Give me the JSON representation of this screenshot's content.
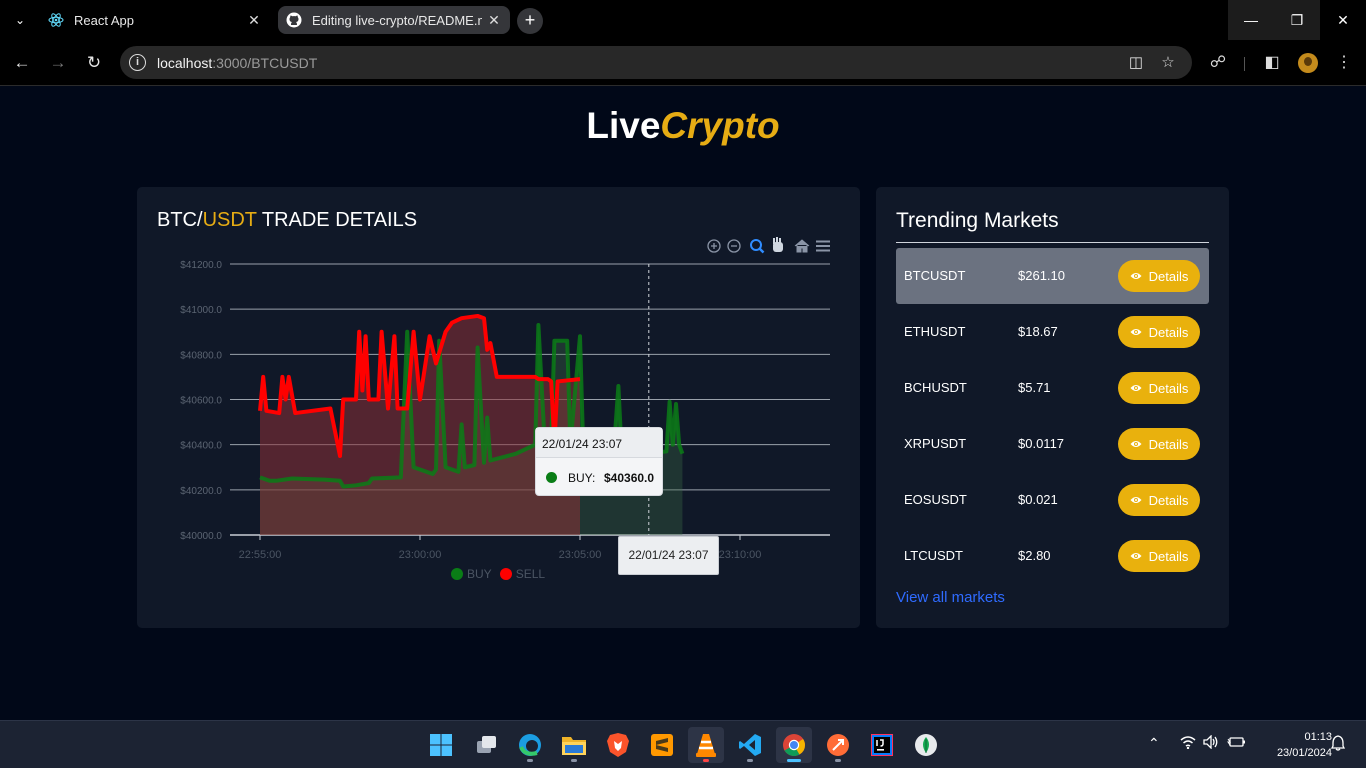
{
  "browser": {
    "tabs": [
      {
        "title": "React App",
        "active": false
      },
      {
        "title": "Editing live-crypto/README.md",
        "active": true
      }
    ],
    "url_host": "localhost",
    "url_path": ":3000/BTCUSDT"
  },
  "brand": {
    "first": "Live",
    "second": "Crypto"
  },
  "trade": {
    "title_base": "BTC/",
    "title_quote": "USDT",
    "title_rest": " TRADE DETAILS"
  },
  "chart_data": {
    "type": "area",
    "title": "BTC/USDT TRADE DETAILS",
    "xlabel": "",
    "ylabel": "",
    "x_ticks": [
      "22:55:00",
      "23:00:00",
      "23:05:00",
      "23:10:00"
    ],
    "y_ticks": [
      "$41200.0",
      "$41000.0",
      "$40800.0",
      "$40600.0",
      "$40400.0",
      "$40200.0",
      "$40000.0"
    ],
    "ylim": [
      40000,
      41200
    ],
    "grid": true,
    "legend": "bottom-center",
    "series": [
      {
        "name": "BUY",
        "color": "#0a7d16",
        "points": [
          [
            0.0,
            40255
          ],
          [
            0.3,
            40240
          ],
          [
            0.5,
            40240
          ],
          [
            1.0,
            40250
          ],
          [
            2.0,
            40245
          ],
          [
            2.5,
            40240
          ],
          [
            2.6,
            40215
          ],
          [
            3.0,
            40220
          ],
          [
            3.4,
            40230
          ],
          [
            3.5,
            40250
          ],
          [
            4.4,
            40255
          ],
          [
            4.6,
            40900
          ],
          [
            4.8,
            40300
          ],
          [
            5.4,
            40270
          ],
          [
            5.5,
            40290
          ],
          [
            5.6,
            40860
          ],
          [
            5.8,
            40300
          ],
          [
            6.2,
            40280
          ],
          [
            6.3,
            40490
          ],
          [
            6.4,
            40300
          ],
          [
            6.7,
            40310
          ],
          [
            6.8,
            40830
          ],
          [
            7.0,
            40320
          ],
          [
            7.1,
            40520
          ],
          [
            7.2,
            40330
          ],
          [
            8.0,
            40360
          ],
          [
            8.6,
            40400
          ],
          [
            8.7,
            40930
          ],
          [
            8.9,
            40400
          ],
          [
            9.1,
            40420
          ],
          [
            9.2,
            40860
          ],
          [
            9.6,
            40860
          ],
          [
            9.7,
            40400
          ],
          [
            10.0,
            40880
          ],
          [
            10.1,
            40390
          ],
          [
            10.3,
            40400
          ],
          [
            10.5,
            40260
          ],
          [
            11.0,
            40260
          ],
          [
            11.2,
            40660
          ],
          [
            11.3,
            40370
          ],
          [
            12.0,
            40360
          ],
          [
            12.7,
            40370
          ],
          [
            12.8,
            40590
          ],
          [
            12.9,
            40400
          ],
          [
            13.0,
            40580
          ],
          [
            13.1,
            40400
          ],
          [
            13.2,
            40360
          ]
        ]
      },
      {
        "name": "SELL",
        "color": "#ff0000",
        "points": [
          [
            0.0,
            40550
          ],
          [
            0.1,
            40700
          ],
          [
            0.2,
            40550
          ],
          [
            0.6,
            40540
          ],
          [
            0.7,
            40700
          ],
          [
            0.8,
            40600
          ],
          [
            0.9,
            40700
          ],
          [
            1.1,
            40540
          ],
          [
            2.2,
            40560
          ],
          [
            2.5,
            40350
          ],
          [
            2.6,
            40600
          ],
          [
            3.0,
            40600
          ],
          [
            3.1,
            40900
          ],
          [
            3.2,
            40640
          ],
          [
            3.3,
            40880
          ],
          [
            3.4,
            40600
          ],
          [
            3.7,
            40600
          ],
          [
            3.8,
            40900
          ],
          [
            4.0,
            40560
          ],
          [
            4.2,
            40880
          ],
          [
            4.3,
            40560
          ],
          [
            4.6,
            40560
          ],
          [
            4.8,
            40900
          ],
          [
            5.0,
            40600
          ],
          [
            5.3,
            40880
          ],
          [
            5.5,
            40760
          ],
          [
            5.8,
            40900
          ],
          [
            6.0,
            40940
          ],
          [
            6.3,
            40960
          ],
          [
            6.8,
            40970
          ],
          [
            7.0,
            40960
          ],
          [
            7.1,
            40820
          ],
          [
            7.2,
            40850
          ],
          [
            7.4,
            40700
          ],
          [
            8.6,
            40700
          ],
          [
            8.7,
            40690
          ],
          [
            9.0,
            40690
          ],
          [
            9.1,
            40680
          ],
          [
            9.2,
            40400
          ],
          [
            9.3,
            40680
          ],
          [
            10.0,
            40690
          ]
        ]
      }
    ],
    "tooltip": {
      "time": "22/01/24 23:07",
      "series": "BUY",
      "value": "$40360.0"
    },
    "crosshair_label": "22/01/24 23:07"
  },
  "toolbar_icons": [
    "zoom-in-icon",
    "zoom-out-icon",
    "selection-zoom-icon",
    "pan-icon",
    "reset-home-icon",
    "menu-icon"
  ],
  "trending": {
    "title": "Trending Markets",
    "rows": [
      {
        "symbol": "BTCUSDT",
        "price": "$261.10",
        "button": "Details",
        "selected": true
      },
      {
        "symbol": "ETHUSDT",
        "price": "$18.67",
        "button": "Details",
        "selected": false
      },
      {
        "symbol": "BCHUSDT",
        "price": "$5.71",
        "button": "Details",
        "selected": false
      },
      {
        "symbol": "XRPUSDT",
        "price": "$0.0117",
        "button": "Details",
        "selected": false
      },
      {
        "symbol": "EOSUSDT",
        "price": "$0.021",
        "button": "Details",
        "selected": false
      },
      {
        "symbol": "LTCUSDT",
        "price": "$2.80",
        "button": "Details",
        "selected": false
      }
    ],
    "view_all": "View all markets"
  },
  "taskbar": {
    "time": "01:13",
    "date": "23/01/2024"
  },
  "colors": {
    "accent": "#e6ac14",
    "background": "#010818",
    "card": "#101828",
    "buy": "#0a7d16",
    "sell": "#ff0000",
    "link": "#2f6bff"
  }
}
